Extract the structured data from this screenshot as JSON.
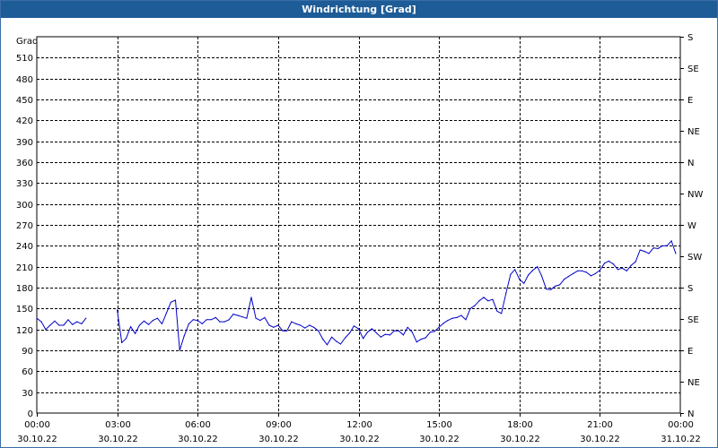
{
  "window": {
    "title": "Windrichtung [Grad]"
  },
  "colors": {
    "titlebar": "#1e5c97",
    "series": "#0000c8",
    "grid": "#000000"
  },
  "chart_data": {
    "type": "line",
    "title": "Windrichtung [Grad]",
    "ylabel": "Grad",
    "ylim": [
      0,
      540
    ],
    "yticks": [
      0,
      30,
      60,
      90,
      120,
      150,
      180,
      210,
      240,
      270,
      300,
      330,
      360,
      390,
      420,
      450,
      480,
      510
    ],
    "right_axis_labels": [
      "N",
      "NE",
      "E",
      "SE",
      "S",
      "SW",
      "W",
      "NW",
      "N",
      "NE",
      "E",
      "SE",
      "S"
    ],
    "right_axis_values": [
      0,
      45,
      90,
      135,
      180,
      225,
      270,
      315,
      360,
      405,
      450,
      495,
      540
    ],
    "xlim_hours": [
      0,
      24
    ],
    "xticks": [
      {
        "time": "00:00",
        "date": "30.10.22",
        "hour": 0
      },
      {
        "time": "03:00",
        "date": "30.10.22",
        "hour": 3
      },
      {
        "time": "06:00",
        "date": "30.10.22",
        "hour": 6
      },
      {
        "time": "09:00",
        "date": "30.10.22",
        "hour": 9
      },
      {
        "time": "12:00",
        "date": "30.10.22",
        "hour": 12
      },
      {
        "time": "15:00",
        "date": "30.10.22",
        "hour": 15
      },
      {
        "time": "18:00",
        "date": "30.10.22",
        "hour": 18
      },
      {
        "time": "21:00",
        "date": "30.10.22",
        "hour": 21
      },
      {
        "time": "00:00",
        "date": "31.10.22",
        "hour": 24
      }
    ],
    "grid": true,
    "series": [
      {
        "segments": [
          [
            [
              0.0,
              136
            ],
            [
              0.17,
              131
            ],
            [
              0.33,
              120
            ],
            [
              0.5,
              126
            ],
            [
              0.67,
              132
            ],
            [
              0.83,
              126
            ],
            [
              1.0,
              126
            ],
            [
              1.17,
              134
            ],
            [
              1.33,
              127
            ],
            [
              1.5,
              131
            ],
            [
              1.67,
              128
            ],
            [
              1.83,
              136
            ]
          ],
          [
            [
              3.0,
              148
            ],
            [
              3.17,
              101
            ],
            [
              3.33,
              107
            ],
            [
              3.5,
              124
            ],
            [
              3.67,
              114
            ],
            [
              3.83,
              126
            ],
            [
              4.0,
              132
            ],
            [
              4.17,
              127
            ],
            [
              4.33,
              133
            ],
            [
              4.5,
              136
            ],
            [
              4.67,
              128
            ],
            [
              4.83,
              143
            ],
            [
              5.0,
              159
            ],
            [
              5.17,
              162
            ],
            [
              5.33,
              90
            ],
            [
              5.5,
              111
            ],
            [
              5.67,
              128
            ],
            [
              5.83,
              134
            ],
            [
              6.0,
              133
            ],
            [
              6.17,
              128
            ],
            [
              6.33,
              134
            ],
            [
              6.5,
              134
            ],
            [
              6.67,
              137
            ],
            [
              6.83,
              131
            ],
            [
              7.0,
              131
            ],
            [
              7.17,
              134
            ],
            [
              7.33,
              142
            ],
            [
              7.5,
              140
            ],
            [
              7.67,
              138
            ],
            [
              7.83,
              136
            ],
            [
              8.0,
              166
            ],
            [
              8.17,
              136
            ],
            [
              8.33,
              133
            ],
            [
              8.5,
              137
            ],
            [
              8.67,
              126
            ],
            [
              8.83,
              123
            ],
            [
              9.0,
              126
            ],
            [
              9.17,
              118
            ],
            [
              9.33,
              118
            ],
            [
              9.5,
              131
            ],
            [
              9.67,
              128
            ],
            [
              9.83,
              126
            ],
            [
              10.0,
              122
            ],
            [
              10.17,
              126
            ],
            [
              10.33,
              123
            ],
            [
              10.5,
              118
            ],
            [
              10.67,
              106
            ],
            [
              10.83,
              98
            ],
            [
              11.0,
              109
            ],
            [
              11.17,
              103
            ],
            [
              11.33,
              99
            ],
            [
              11.5,
              108
            ],
            [
              11.67,
              115
            ],
            [
              11.83,
              125
            ],
            [
              12.0,
              121
            ],
            [
              12.17,
              107
            ],
            [
              12.33,
              116
            ],
            [
              12.5,
              121
            ],
            [
              12.67,
              115
            ],
            [
              12.83,
              109
            ],
            [
              13.0,
              113
            ],
            [
              13.17,
              112
            ],
            [
              13.33,
              118
            ],
            [
              13.5,
              118
            ],
            [
              13.67,
              112
            ],
            [
              13.83,
              123
            ],
            [
              14.0,
              116
            ],
            [
              14.17,
              102
            ],
            [
              14.33,
              106
            ],
            [
              14.5,
              108
            ],
            [
              14.67,
              116
            ],
            [
              14.83,
              117
            ],
            [
              15.0,
              123
            ],
            [
              15.17,
              129
            ],
            [
              15.33,
              133
            ],
            [
              15.5,
              136
            ],
            [
              15.67,
              137
            ],
            [
              15.83,
              140
            ],
            [
              16.0,
              134
            ],
            [
              16.17,
              150
            ],
            [
              16.33,
              154
            ],
            [
              16.5,
              161
            ],
            [
              16.67,
              166
            ],
            [
              16.83,
              161
            ],
            [
              17.0,
              163
            ],
            [
              17.17,
              146
            ],
            [
              17.33,
              143
            ],
            [
              17.5,
              172
            ],
            [
              17.67,
              199
            ],
            [
              17.83,
              206
            ],
            [
              18.0,
              192
            ],
            [
              18.17,
              186
            ],
            [
              18.33,
              198
            ],
            [
              18.5,
              205
            ],
            [
              18.67,
              210
            ],
            [
              18.83,
              197
            ],
            [
              19.0,
              178
            ],
            [
              19.17,
              177
            ],
            [
              19.33,
              182
            ],
            [
              19.5,
              184
            ],
            [
              19.67,
              192
            ],
            [
              19.83,
              196
            ],
            [
              20.0,
              200
            ],
            [
              20.17,
              204
            ],
            [
              20.33,
              204
            ],
            [
              20.5,
              202
            ],
            [
              20.67,
              197
            ],
            [
              20.83,
              200
            ],
            [
              21.0,
              205
            ],
            [
              21.17,
              215
            ],
            [
              21.33,
              218
            ],
            [
              21.5,
              214
            ],
            [
              21.67,
              206
            ],
            [
              21.83,
              208
            ],
            [
              22.0,
              204
            ],
            [
              22.17,
              212
            ],
            [
              22.33,
              217
            ],
            [
              22.5,
              234
            ],
            [
              22.67,
              232
            ],
            [
              22.83,
              229
            ],
            [
              23.0,
              237
            ],
            [
              23.17,
              236
            ],
            [
              23.33,
              240
            ],
            [
              23.5,
              240
            ],
            [
              23.67,
              247
            ],
            [
              23.83,
              229
            ]
          ]
        ]
      }
    ]
  }
}
